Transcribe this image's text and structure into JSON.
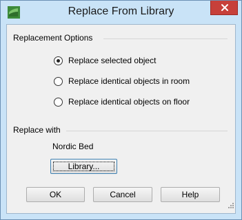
{
  "window": {
    "title": "Replace From Library",
    "accent": "#c9e3f7",
    "close_color": "#c7403a"
  },
  "replacement_options": {
    "label": "Replacement Options",
    "options": [
      {
        "label": "Replace selected object",
        "selected": true
      },
      {
        "label": "Replace identical objects in room",
        "selected": false
      },
      {
        "label": "Replace identical objects on floor",
        "selected": false
      }
    ]
  },
  "replace_with": {
    "label": "Replace with",
    "object_name": "Nordic Bed",
    "library_button": "Library..."
  },
  "footer": {
    "ok": "OK",
    "cancel": "Cancel",
    "help": "Help"
  },
  "icons": {
    "app": "app-icon",
    "close": "close-icon",
    "resize": "resize-grip-icon"
  }
}
